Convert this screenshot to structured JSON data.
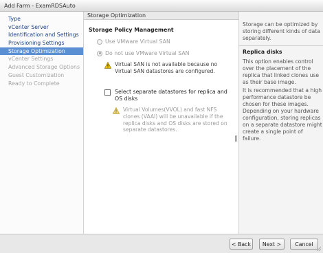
{
  "window": {
    "title": "Add Farm - ExamRDSAuto"
  },
  "nav": {
    "items": [
      {
        "label": "Type",
        "state": "normal"
      },
      {
        "label": "vCenter Server",
        "state": "normal"
      },
      {
        "label": "Identification and Settings",
        "state": "normal"
      },
      {
        "label": "Provisioning Settings",
        "state": "normal"
      },
      {
        "label": "Storage Optimization",
        "state": "active"
      },
      {
        "label": "vCenter Settings",
        "state": "disabled"
      },
      {
        "label": "Advanced Storage Options",
        "state": "disabled"
      },
      {
        "label": "Guest Customization",
        "state": "disabled"
      },
      {
        "label": "Ready to Complete",
        "state": "disabled"
      }
    ]
  },
  "content": {
    "header": "Storage Optimization",
    "section_title": "Storage Policy Management",
    "radio_use_vsan": "Use VMware Virtual SAN",
    "radio_no_vsan": "Do not use VMware Virtual SAN",
    "warning_vsan": "Virtual SAN is not available because no Virtual SAN datastores are configured.",
    "checkbox_separate": "Select separate datastores for replica and OS disks",
    "warning_vvol": "Virtual Volumes(VVOL) and fast NFS clones (VAAI) will be unavailable if the replica disks and OS disks are stored on separate datastores."
  },
  "help": {
    "intro": "Storage can be optimized by storing different kinds of data separately.",
    "title": "Replica disks",
    "p1": "This option enables control over the placement of the replica that linked clones use as their base image.",
    "p2": "It is recommended that a high performance datastore be chosen for these images. Depending on your hardware configuration, storing replicas on a separate datastore might create a single point of failure."
  },
  "footer": {
    "back": "< Back",
    "next": "Next >",
    "cancel": "Cancel"
  },
  "colors": {
    "nav_active_bg": "#5b8fd3",
    "nav_link": "#1d3f86",
    "warning_yellow": "#f2c500"
  }
}
